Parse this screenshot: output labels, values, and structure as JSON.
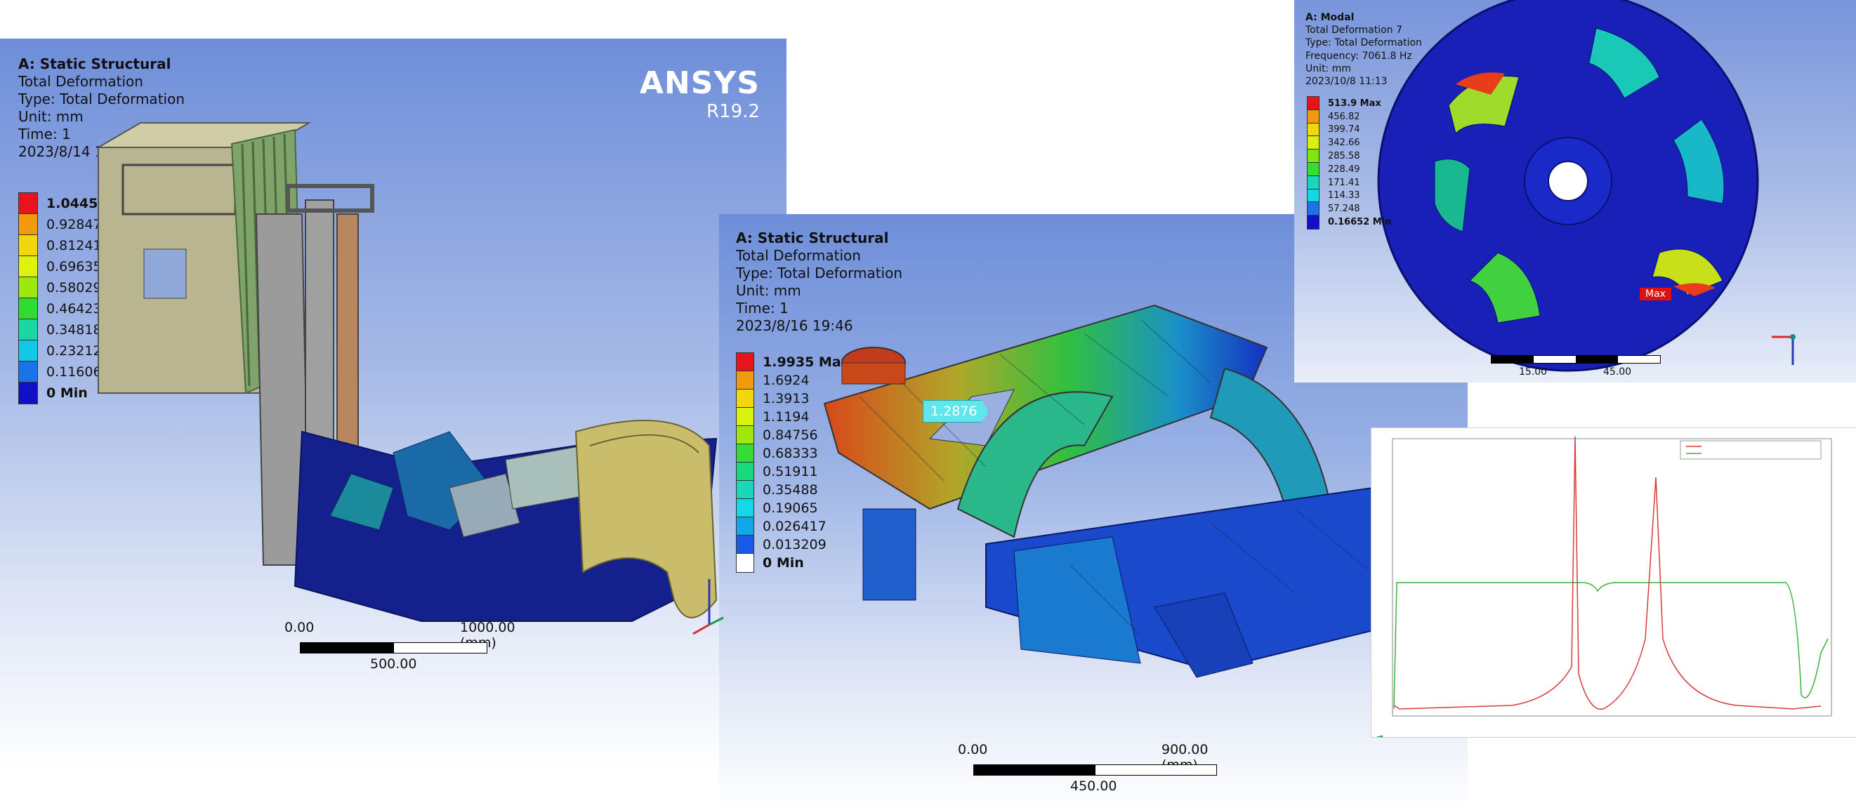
{
  "panel1": {
    "header": [
      "A: Static Structural",
      "Total Deformation",
      "Type: Total Deformation",
      "Unit: mm",
      "Time: 1",
      "2023/8/14 15:57"
    ],
    "brand": "ANSYS",
    "version": "R19.2",
    "legend": [
      {
        "label": "1.0445 Max",
        "color": "#e8141b"
      },
      {
        "label": "0.92847",
        "color": "#f29a0e"
      },
      {
        "label": "0.81241",
        "color": "#f2d60e"
      },
      {
        "label": "0.69635",
        "color": "#dff20e"
      },
      {
        "label": "0.58029",
        "color": "#9ee80e"
      },
      {
        "label": "0.46423",
        "color": "#2fdc2f"
      },
      {
        "label": "0.34818",
        "color": "#19d8a4"
      },
      {
        "label": "0.23212",
        "color": "#12c8e8"
      },
      {
        "label": "0.11606",
        "color": "#1a74e8"
      },
      {
        "label": "0 Min",
        "color": "#1010c8"
      }
    ],
    "scale": {
      "left": "0.00",
      "right": "1000.00 (mm)",
      "mid": "500.00"
    }
  },
  "panel2": {
    "header": [
      "A: Static Structural",
      "Total Deformation",
      "Type: Total Deformation",
      "Unit: mm",
      "Time: 1",
      "2023/8/16 19:46"
    ],
    "legend": [
      {
        "label": "1.9935 Max",
        "color": "#e8141b"
      },
      {
        "label": "1.6924",
        "color": "#f29a0e"
      },
      {
        "label": "1.3913",
        "color": "#f2d60e"
      },
      {
        "label": "1.1194",
        "color": "#d8f20e"
      },
      {
        "label": "0.84756",
        "color": "#9ee80e"
      },
      {
        "label": "0.68333",
        "color": "#35dc35"
      },
      {
        "label": "0.51911",
        "color": "#19d87e"
      },
      {
        "label": "0.35488",
        "color": "#19d8b8"
      },
      {
        "label": "0.19065",
        "color": "#12d8e8"
      },
      {
        "label": "0.026417",
        "color": "#12a8e8"
      },
      {
        "label": "0.013209",
        "color": "#1a5ae8"
      },
      {
        "label": "0 Min",
        "color": "#ffffff"
      }
    ],
    "probe": "1.2876",
    "scale": {
      "left": "0.00",
      "right": "900.00 (mm)",
      "mid": "450.00"
    }
  },
  "panel3": {
    "header": [
      "A: Modal",
      "Total Deformation 7",
      "Type: Total Deformation",
      "Frequency: 7061.8 Hz",
      "Unit: mm",
      "2023/10/8 11:13"
    ],
    "legend": [
      {
        "label": "513.9 Max",
        "color": "#e8141b"
      },
      {
        "label": "456.82",
        "color": "#f29a0e"
      },
      {
        "label": "399.74",
        "color": "#f2d60e"
      },
      {
        "label": "342.66",
        "color": "#d8f20e"
      },
      {
        "label": "285.58",
        "color": "#7ee80e"
      },
      {
        "label": "228.49",
        "color": "#35dc35"
      },
      {
        "label": "171.41",
        "color": "#19d8b8"
      },
      {
        "label": "114.33",
        "color": "#12d8e8"
      },
      {
        "label": "57.248",
        "color": "#1a74e8"
      },
      {
        "label": "0.16652 Min",
        "color": "#1010c8"
      }
    ],
    "maxtag": "Max",
    "scale": {
      "left": "15.00",
      "right": "45.00"
    }
  },
  "colors": {
    "green_curve": "#3cb43c",
    "red_curve": "#d83c3c"
  }
}
